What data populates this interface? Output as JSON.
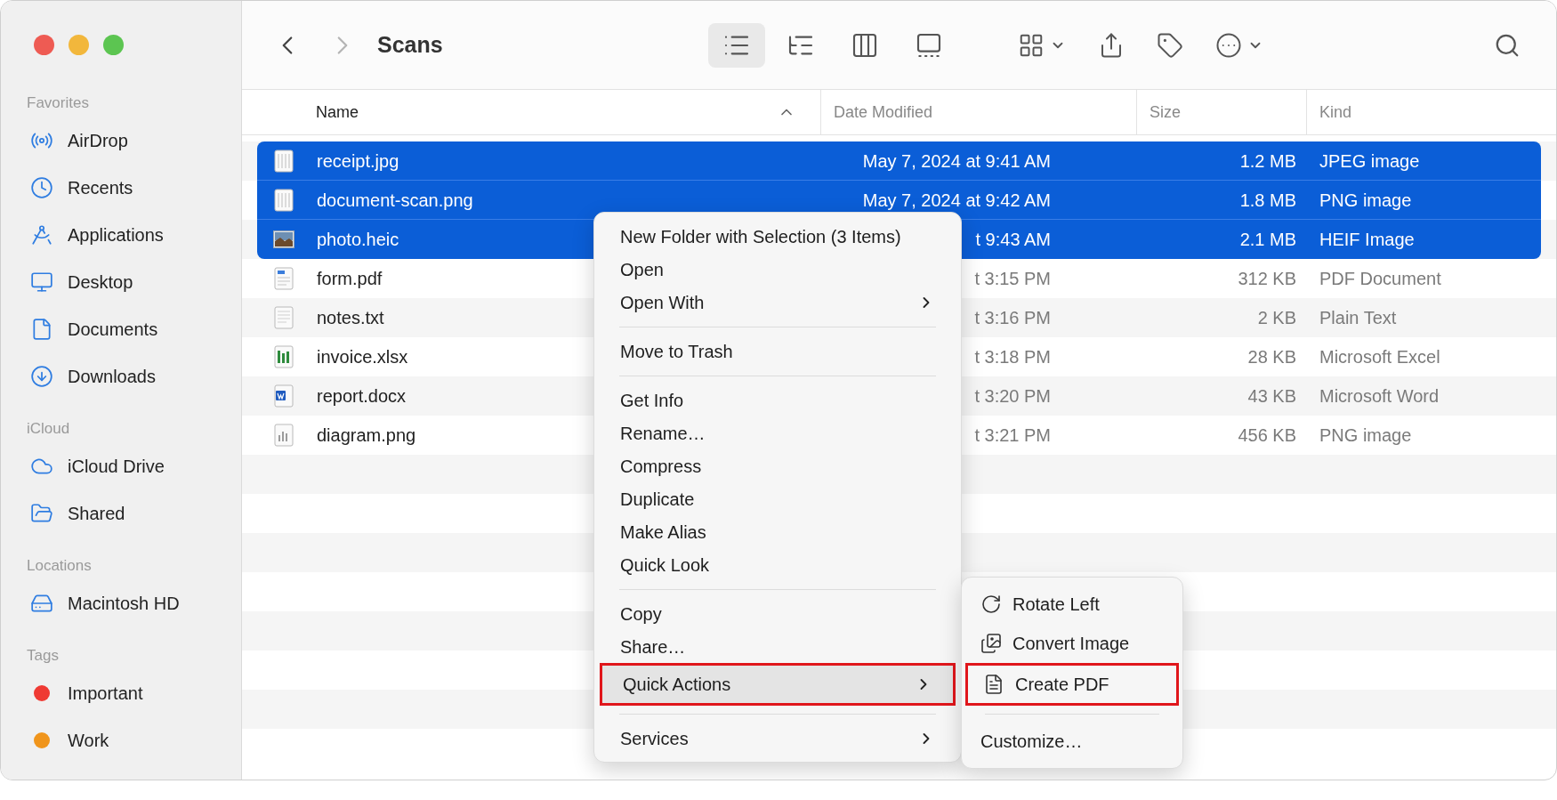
{
  "window": {
    "title": "Scans",
    "back_enabled": true,
    "forward_enabled": false
  },
  "toolbar": {
    "view_modes": [
      {
        "kind": "list",
        "selected": true
      },
      {
        "kind": "outline",
        "selected": false
      },
      {
        "kind": "columns",
        "selected": false
      },
      {
        "kind": "gallery",
        "selected": false
      }
    ],
    "actions": [
      {
        "kind": "group",
        "menu": true
      },
      {
        "kind": "share",
        "menu": false
      },
      {
        "kind": "tag",
        "menu": false
      },
      {
        "kind": "more",
        "menu": true
      }
    ]
  },
  "sidebar": {
    "sections": [
      {
        "title": "Favorites",
        "items": [
          {
            "kind": "airdrop",
            "label": "AirDrop"
          },
          {
            "kind": "recents",
            "label": "Recents"
          },
          {
            "kind": "applications",
            "label": "Applications"
          },
          {
            "kind": "desktop",
            "label": "Desktop"
          },
          {
            "kind": "documents",
            "label": "Documents"
          },
          {
            "kind": "downloads",
            "label": "Downloads"
          }
        ]
      },
      {
        "title": "iCloud",
        "items": [
          {
            "kind": "cloud",
            "label": "iCloud Drive"
          },
          {
            "kind": "shared",
            "label": "Shared"
          }
        ]
      },
      {
        "title": "Locations",
        "items": [
          {
            "kind": "disk",
            "label": "Macintosh HD"
          }
        ]
      },
      {
        "title": "Tags",
        "items": [
          {
            "kind": "tag",
            "label": "Important",
            "color": "#ef3a33"
          },
          {
            "kind": "tag",
            "label": "Work",
            "color": "#f0951c"
          }
        ]
      }
    ]
  },
  "table": {
    "columns": [
      {
        "label": "Name",
        "sorted": true
      },
      {
        "label": "Date Modified",
        "sorted": false
      },
      {
        "label": "Size",
        "sorted": false
      },
      {
        "label": "Kind",
        "sorted": false
      }
    ],
    "rows": [
      {
        "kind": "scan",
        "name": "receipt.jpg",
        "date_modified": "May 7, 2024 at 9:41 AM",
        "size": "1.2 MB",
        "file_kind": "JPEG image",
        "selected": true
      },
      {
        "kind": "scan",
        "name": "document-scan.png",
        "date_modified": "May 7, 2024 at 9:42 AM",
        "size": "1.8 MB",
        "file_kind": "PNG image",
        "selected": true
      },
      {
        "kind": "photo",
        "name": "photo.heic",
        "date_modified": "t 9:43 AM",
        "size": "2.1 MB",
        "file_kind": "HEIF Image",
        "selected": true
      },
      {
        "kind": "pdf",
        "name": "form.pdf",
        "date_modified": "t 3:15 PM",
        "size": "312 KB",
        "file_kind": "PDF Document",
        "selected": false
      },
      {
        "kind": "text",
        "name": "notes.txt",
        "date_modified": "t 3:16 PM",
        "size": "2 KB",
        "file_kind": "Plain Text",
        "selected": false
      },
      {
        "kind": "sheet",
        "name": "invoice.xlsx",
        "date_modified": "t 3:18 PM",
        "size": "28 KB",
        "file_kind": "Microsoft Excel",
        "selected": false
      },
      {
        "kind": "word",
        "name": "report.docx",
        "date_modified": "t 3:20 PM",
        "size": "43 KB",
        "file_kind": "Microsoft Word",
        "selected": false
      },
      {
        "kind": "chart",
        "name": "diagram.png",
        "date_modified": "t 3:21 PM",
        "size": "456 KB",
        "file_kind": "PNG image",
        "selected": false
      }
    ]
  },
  "context_menu": {
    "items": [
      {
        "kind": "action",
        "label": "New Folder with Selection (3 Items)",
        "selected": false,
        "outlined": false
      },
      {
        "kind": "action",
        "label": "Open",
        "selected": false,
        "outlined": false
      },
      {
        "kind": "submenu",
        "label": "Open With",
        "selected": false,
        "outlined": false
      },
      {
        "kind": "separator"
      },
      {
        "kind": "action",
        "label": "Move to Trash",
        "selected": false,
        "outlined": false
      },
      {
        "kind": "separator"
      },
      {
        "kind": "action",
        "label": "Get Info",
        "selected": false,
        "outlined": false
      },
      {
        "kind": "action",
        "label": "Rename…",
        "selected": false,
        "outlined": false
      },
      {
        "kind": "action",
        "label": "Compress",
        "selected": false,
        "outlined": false
      },
      {
        "kind": "action",
        "label": "Duplicate",
        "selected": false,
        "outlined": false
      },
      {
        "kind": "action",
        "label": "Make Alias",
        "selected": false,
        "outlined": false
      },
      {
        "kind": "action",
        "label": "Quick Look",
        "selected": false,
        "outlined": false
      },
      {
        "kind": "separator"
      },
      {
        "kind": "action",
        "label": "Copy",
        "selected": false,
        "outlined": false
      },
      {
        "kind": "action",
        "label": "Share…",
        "selected": false,
        "outlined": false
      },
      {
        "kind": "submenu",
        "label": "Quick Actions",
        "selected": true,
        "outlined": true
      },
      {
        "kind": "separator"
      },
      {
        "kind": "submenu",
        "label": "Services",
        "selected": false,
        "outlined": false
      }
    ]
  },
  "quick_actions_menu": {
    "items": [
      {
        "kind": "rotate",
        "label": "Rotate Left",
        "selected": false,
        "outlined": false
      },
      {
        "kind": "convert",
        "label": "Convert Image",
        "selected": false,
        "outlined": false
      },
      {
        "kind": "pdf",
        "label": "Create PDF",
        "selected": false,
        "outlined": true
      },
      {
        "kind": "separator"
      },
      {
        "kind": "plain",
        "label": "Customize…",
        "selected": false,
        "outlined": false
      }
    ]
  }
}
